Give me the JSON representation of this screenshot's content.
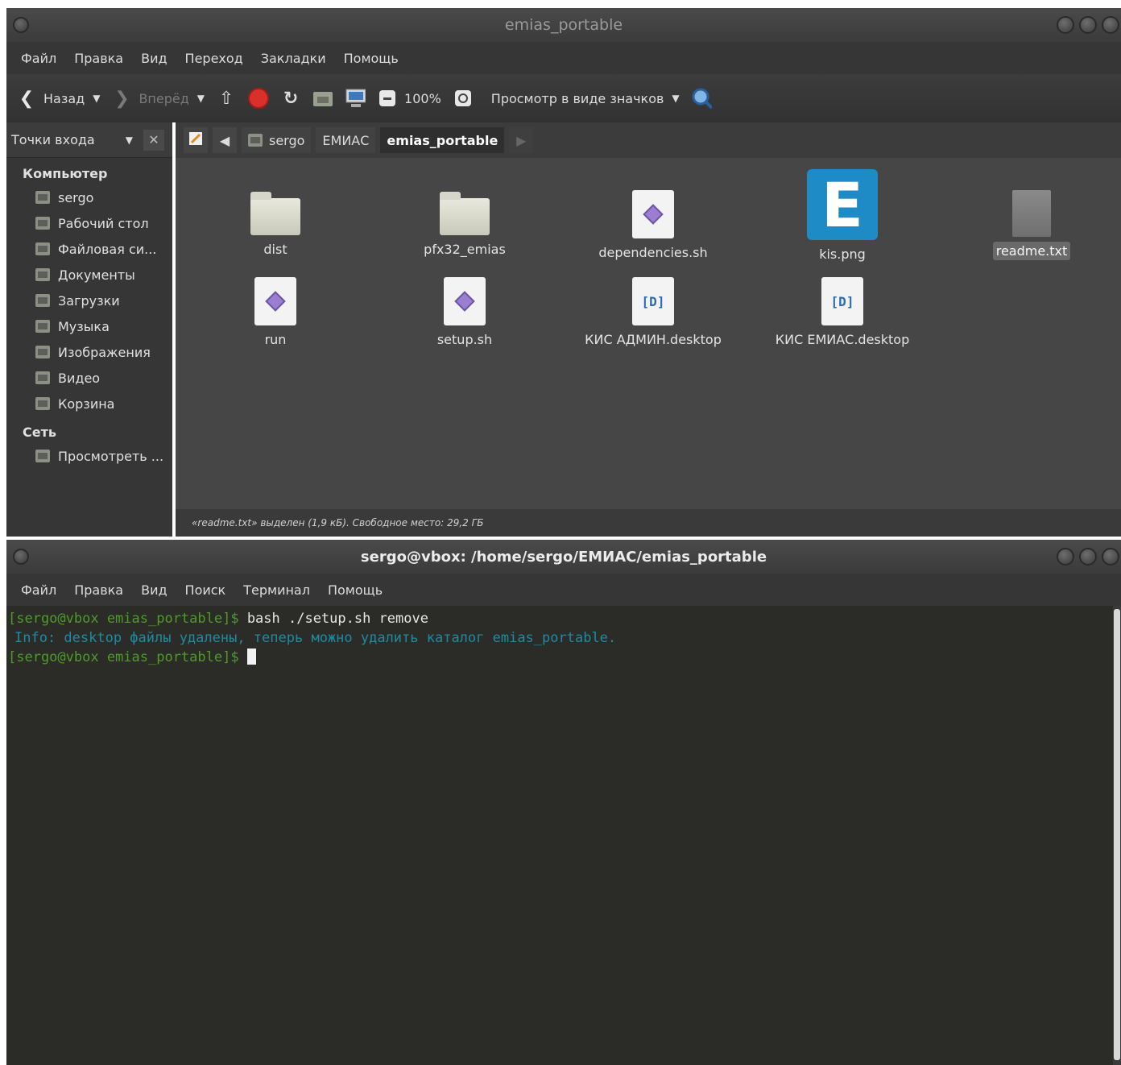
{
  "fm": {
    "title": "emias_portable",
    "menu": [
      "Файл",
      "Правка",
      "Вид",
      "Переход",
      "Закладки",
      "Помощь"
    ],
    "toolbar": {
      "back": "Назад",
      "forward": "Вперёд",
      "zoom": "100%",
      "view_mode": "Просмотр в виде значков"
    },
    "sidebar": {
      "selector": "Точки входа",
      "section_computer": "Компьютер",
      "computer_items": [
        "sergo",
        "Рабочий стол",
        "Файловая си...",
        "Документы",
        "Загрузки",
        "Музыка",
        "Изображения",
        "Видео",
        "Корзина"
      ],
      "section_network": "Сеть",
      "network_items": [
        "Просмотреть ..."
      ]
    },
    "path": [
      "sergo",
      "ЕМИАС",
      "emias_portable"
    ],
    "files": [
      {
        "name": "dist",
        "type": "folder"
      },
      {
        "name": "pfx32_emias",
        "type": "folder"
      },
      {
        "name": "dependencies.sh",
        "type": "script"
      },
      {
        "name": "kis.png",
        "type": "image"
      },
      {
        "name": "readme.txt",
        "type": "text",
        "selected": true
      },
      {
        "name": "run",
        "type": "script"
      },
      {
        "name": "setup.sh",
        "type": "script"
      },
      {
        "name": "КИС АДМИН.desktop",
        "type": "desktop"
      },
      {
        "name": "КИС ЕМИАС.desktop",
        "type": "desktop"
      }
    ],
    "kis_letter": "E",
    "desktop_glyph": "[D]",
    "status": "«readme.txt» выделен (1,9 кБ). Свободное место: 29,2 ГБ"
  },
  "term": {
    "title": "sergo@vbox: /home/sergo/ЕМИАС/emias_portable",
    "menu": [
      "Файл",
      "Правка",
      "Вид",
      "Поиск",
      "Терминал",
      "Помощь"
    ],
    "prompt": "[sergo@vbox emias_portable]$",
    "command": " bash ./setup.sh remove",
    "info": "Info: desktop файлы удалены, теперь можно удалить каталог emias_portable."
  },
  "colors": {
    "prompt": "#4e9a2c",
    "info": "#1f8aa0",
    "kis_accent": "#1f8bc6"
  }
}
